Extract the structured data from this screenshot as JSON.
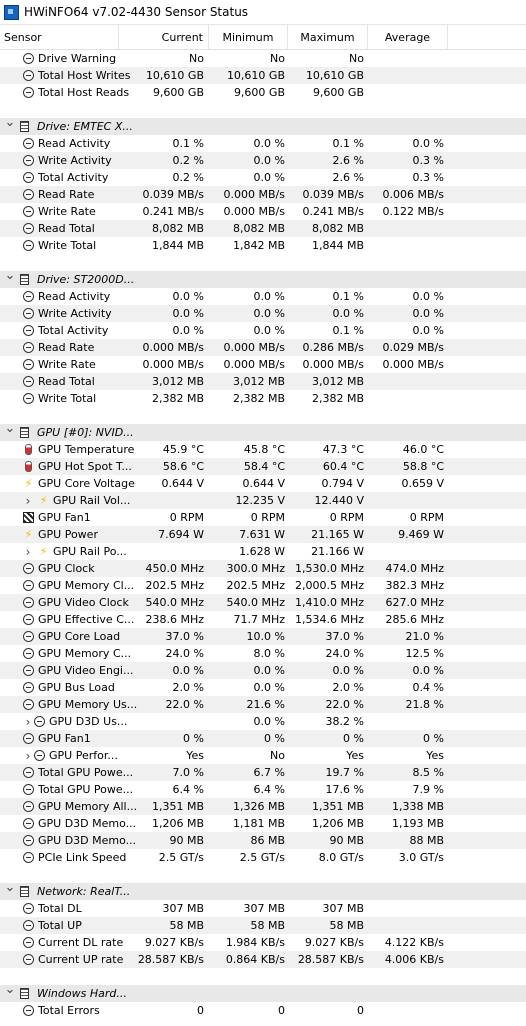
{
  "window": {
    "title": "HWiNFO64 v7.02-4430 Sensor Status"
  },
  "columns": {
    "sensor": "Sensor",
    "current": "Current",
    "minimum": "Minimum",
    "maximum": "Maximum",
    "average": "Average"
  },
  "rows": [
    {
      "type": "item",
      "icon": "circle",
      "label": "Drive Warning",
      "cur": "No",
      "min": "No",
      "max": "No",
      "avg": ""
    },
    {
      "type": "item",
      "icon": "circle",
      "label": "Total Host Writes",
      "cur": "10,610 GB",
      "min": "10,610 GB",
      "max": "10,610 GB",
      "avg": ""
    },
    {
      "type": "item",
      "icon": "circle",
      "label": "Total Host Reads",
      "cur": "9,600 GB",
      "min": "9,600 GB",
      "max": "9,600 GB",
      "avg": ""
    },
    {
      "type": "gap"
    },
    {
      "type": "group",
      "icon": "chip",
      "label": "Drive: EMTEC X..."
    },
    {
      "type": "item",
      "icon": "circle",
      "label": "Read Activity",
      "cur": "0.1 %",
      "min": "0.0 %",
      "max": "0.1 %",
      "avg": "0.0 %"
    },
    {
      "type": "item",
      "icon": "circle",
      "label": "Write Activity",
      "cur": "0.2 %",
      "min": "0.0 %",
      "max": "2.6 %",
      "avg": "0.3 %"
    },
    {
      "type": "item",
      "icon": "circle",
      "label": "Total Activity",
      "cur": "0.2 %",
      "min": "0.0 %",
      "max": "2.6 %",
      "avg": "0.3 %"
    },
    {
      "type": "item",
      "icon": "circle",
      "label": "Read Rate",
      "cur": "0.039 MB/s",
      "min": "0.000 MB/s",
      "max": "0.039 MB/s",
      "avg": "0.006 MB/s"
    },
    {
      "type": "item",
      "icon": "circle",
      "label": "Write Rate",
      "cur": "0.241 MB/s",
      "min": "0.000 MB/s",
      "max": "0.241 MB/s",
      "avg": "0.122 MB/s"
    },
    {
      "type": "item",
      "icon": "circle",
      "label": "Read Total",
      "cur": "8,082 MB",
      "min": "8,082 MB",
      "max": "8,082 MB",
      "avg": ""
    },
    {
      "type": "item",
      "icon": "circle",
      "label": "Write Total",
      "cur": "1,844 MB",
      "min": "1,842 MB",
      "max": "1,844 MB",
      "avg": ""
    },
    {
      "type": "gap"
    },
    {
      "type": "group",
      "icon": "chip",
      "label": "Drive: ST2000D..."
    },
    {
      "type": "item",
      "icon": "circle",
      "label": "Read Activity",
      "cur": "0.0 %",
      "min": "0.0 %",
      "max": "0.1 %",
      "avg": "0.0 %"
    },
    {
      "type": "item",
      "icon": "circle",
      "label": "Write Activity",
      "cur": "0.0 %",
      "min": "0.0 %",
      "max": "0.0 %",
      "avg": "0.0 %"
    },
    {
      "type": "item",
      "icon": "circle",
      "label": "Total Activity",
      "cur": "0.0 %",
      "min": "0.0 %",
      "max": "0.1 %",
      "avg": "0.0 %"
    },
    {
      "type": "item",
      "icon": "circle",
      "label": "Read Rate",
      "cur": "0.000 MB/s",
      "min": "0.000 MB/s",
      "max": "0.286 MB/s",
      "avg": "0.029 MB/s"
    },
    {
      "type": "item",
      "icon": "circle",
      "label": "Write Rate",
      "cur": "0.000 MB/s",
      "min": "0.000 MB/s",
      "max": "0.000 MB/s",
      "avg": "0.000 MB/s"
    },
    {
      "type": "item",
      "icon": "circle",
      "label": "Read Total",
      "cur": "3,012 MB",
      "min": "3,012 MB",
      "max": "3,012 MB",
      "avg": ""
    },
    {
      "type": "item",
      "icon": "circle",
      "label": "Write Total",
      "cur": "2,382 MB",
      "min": "2,382 MB",
      "max": "2,382 MB",
      "avg": ""
    },
    {
      "type": "gap"
    },
    {
      "type": "group",
      "icon": "chip",
      "label": "GPU [#0]: NVID..."
    },
    {
      "type": "item",
      "icon": "thermo",
      "label": "GPU Temperature",
      "cur": "45.9 °C",
      "min": "45.8 °C",
      "max": "47.3 °C",
      "avg": "46.0 °C"
    },
    {
      "type": "item",
      "icon": "thermo",
      "label": "GPU Hot Spot T...",
      "cur": "58.6 °C",
      "min": "58.4 °C",
      "max": "60.4 °C",
      "avg": "58.8 °C"
    },
    {
      "type": "item",
      "icon": "bolt",
      "label": "GPU Core Voltage",
      "cur": "0.644 V",
      "min": "0.644 V",
      "max": "0.794 V",
      "avg": "0.659 V"
    },
    {
      "type": "sub",
      "icon": "bolt",
      "label": "GPU Rail Vol...",
      "cur": "",
      "min": "12.235 V",
      "max": "12.440 V",
      "avg": ""
    },
    {
      "type": "item",
      "icon": "fan",
      "label": "GPU Fan1",
      "cur": "0 RPM",
      "min": "0 RPM",
      "max": "0 RPM",
      "avg": "0 RPM"
    },
    {
      "type": "item",
      "icon": "bolt",
      "label": "GPU Power",
      "cur": "7.694 W",
      "min": "7.631 W",
      "max": "21.165 W",
      "avg": "9.469 W"
    },
    {
      "type": "sub",
      "icon": "bolt",
      "label": "GPU Rail Po...",
      "cur": "",
      "min": "1.628 W",
      "max": "21.166 W",
      "avg": ""
    },
    {
      "type": "item",
      "icon": "circle",
      "label": "GPU Clock",
      "cur": "450.0 MHz",
      "min": "300.0 MHz",
      "max": "1,530.0 MHz",
      "avg": "474.0 MHz"
    },
    {
      "type": "item",
      "icon": "circle",
      "label": "GPU Memory Cl...",
      "cur": "202.5 MHz",
      "min": "202.5 MHz",
      "max": "2,000.5 MHz",
      "avg": "382.3 MHz"
    },
    {
      "type": "item",
      "icon": "circle",
      "label": "GPU Video Clock",
      "cur": "540.0 MHz",
      "min": "540.0 MHz",
      "max": "1,410.0 MHz",
      "avg": "627.0 MHz"
    },
    {
      "type": "item",
      "icon": "circle",
      "label": "GPU Effective C...",
      "cur": "238.6 MHz",
      "min": "71.7 MHz",
      "max": "1,534.6 MHz",
      "avg": "285.6 MHz"
    },
    {
      "type": "item",
      "icon": "circle",
      "label": "GPU Core Load",
      "cur": "37.0 %",
      "min": "10.0 %",
      "max": "37.0 %",
      "avg": "21.0 %"
    },
    {
      "type": "item",
      "icon": "circle",
      "label": "GPU Memory C...",
      "cur": "24.0 %",
      "min": "8.0 %",
      "max": "24.0 %",
      "avg": "12.5 %"
    },
    {
      "type": "item",
      "icon": "circle",
      "label": "GPU Video Engi...",
      "cur": "0.0 %",
      "min": "0.0 %",
      "max": "0.0 %",
      "avg": "0.0 %"
    },
    {
      "type": "item",
      "icon": "circle",
      "label": "GPU Bus Load",
      "cur": "2.0 %",
      "min": "0.0 %",
      "max": "2.0 %",
      "avg": "0.4 %"
    },
    {
      "type": "item",
      "icon": "circle",
      "label": "GPU Memory Us...",
      "cur": "22.0 %",
      "min": "21.6 %",
      "max": "22.0 %",
      "avg": "21.8 %"
    },
    {
      "type": "sub",
      "icon": "circle",
      "label": "GPU D3D Us...",
      "cur": "",
      "min": "0.0 %",
      "max": "38.2 %",
      "avg": ""
    },
    {
      "type": "item",
      "icon": "circle",
      "label": "GPU Fan1",
      "cur": "0 %",
      "min": "0 %",
      "max": "0 %",
      "avg": "0 %"
    },
    {
      "type": "sub",
      "icon": "circle",
      "label": "GPU Perfor...",
      "cur": "Yes",
      "min": "No",
      "max": "Yes",
      "avg": "Yes"
    },
    {
      "type": "item",
      "icon": "circle",
      "label": "Total GPU Powe...",
      "cur": "7.0 %",
      "min": "6.7 %",
      "max": "19.7 %",
      "avg": "8.5 %"
    },
    {
      "type": "item",
      "icon": "circle",
      "label": "Total GPU Powe...",
      "cur": "6.4 %",
      "min": "6.4 %",
      "max": "17.6 %",
      "avg": "7.9 %"
    },
    {
      "type": "item",
      "icon": "circle",
      "label": "GPU Memory All...",
      "cur": "1,351 MB",
      "min": "1,326 MB",
      "max": "1,351 MB",
      "avg": "1,338 MB"
    },
    {
      "type": "item",
      "icon": "circle",
      "label": "GPU D3D Memo...",
      "cur": "1,206 MB",
      "min": "1,181 MB",
      "max": "1,206 MB",
      "avg": "1,193 MB"
    },
    {
      "type": "item",
      "icon": "circle",
      "label": "GPU D3D Memo...",
      "cur": "90 MB",
      "min": "86 MB",
      "max": "90 MB",
      "avg": "88 MB"
    },
    {
      "type": "item",
      "icon": "circle",
      "label": "PCIe Link Speed",
      "cur": "2.5 GT/s",
      "min": "2.5 GT/s",
      "max": "8.0 GT/s",
      "avg": "3.0 GT/s"
    },
    {
      "type": "gap"
    },
    {
      "type": "group",
      "icon": "chip",
      "label": "Network: RealT..."
    },
    {
      "type": "item",
      "icon": "circle",
      "label": "Total DL",
      "cur": "307 MB",
      "min": "307 MB",
      "max": "307 MB",
      "avg": ""
    },
    {
      "type": "item",
      "icon": "circle",
      "label": "Total UP",
      "cur": "58 MB",
      "min": "58 MB",
      "max": "58 MB",
      "avg": ""
    },
    {
      "type": "item",
      "icon": "circle",
      "label": "Current DL rate",
      "cur": "9.027 KB/s",
      "min": "1.984 KB/s",
      "max": "9.027 KB/s",
      "avg": "4.122 KB/s"
    },
    {
      "type": "item",
      "icon": "circle",
      "label": "Current UP rate",
      "cur": "28.587 KB/s",
      "min": "0.864 KB/s",
      "max": "28.587 KB/s",
      "avg": "4.006 KB/s"
    },
    {
      "type": "gap"
    },
    {
      "type": "group",
      "icon": "chip",
      "label": "Windows Hard..."
    },
    {
      "type": "item",
      "icon": "circle",
      "label": "Total Errors",
      "cur": "0",
      "min": "0",
      "max": "0",
      "avg": ""
    }
  ]
}
